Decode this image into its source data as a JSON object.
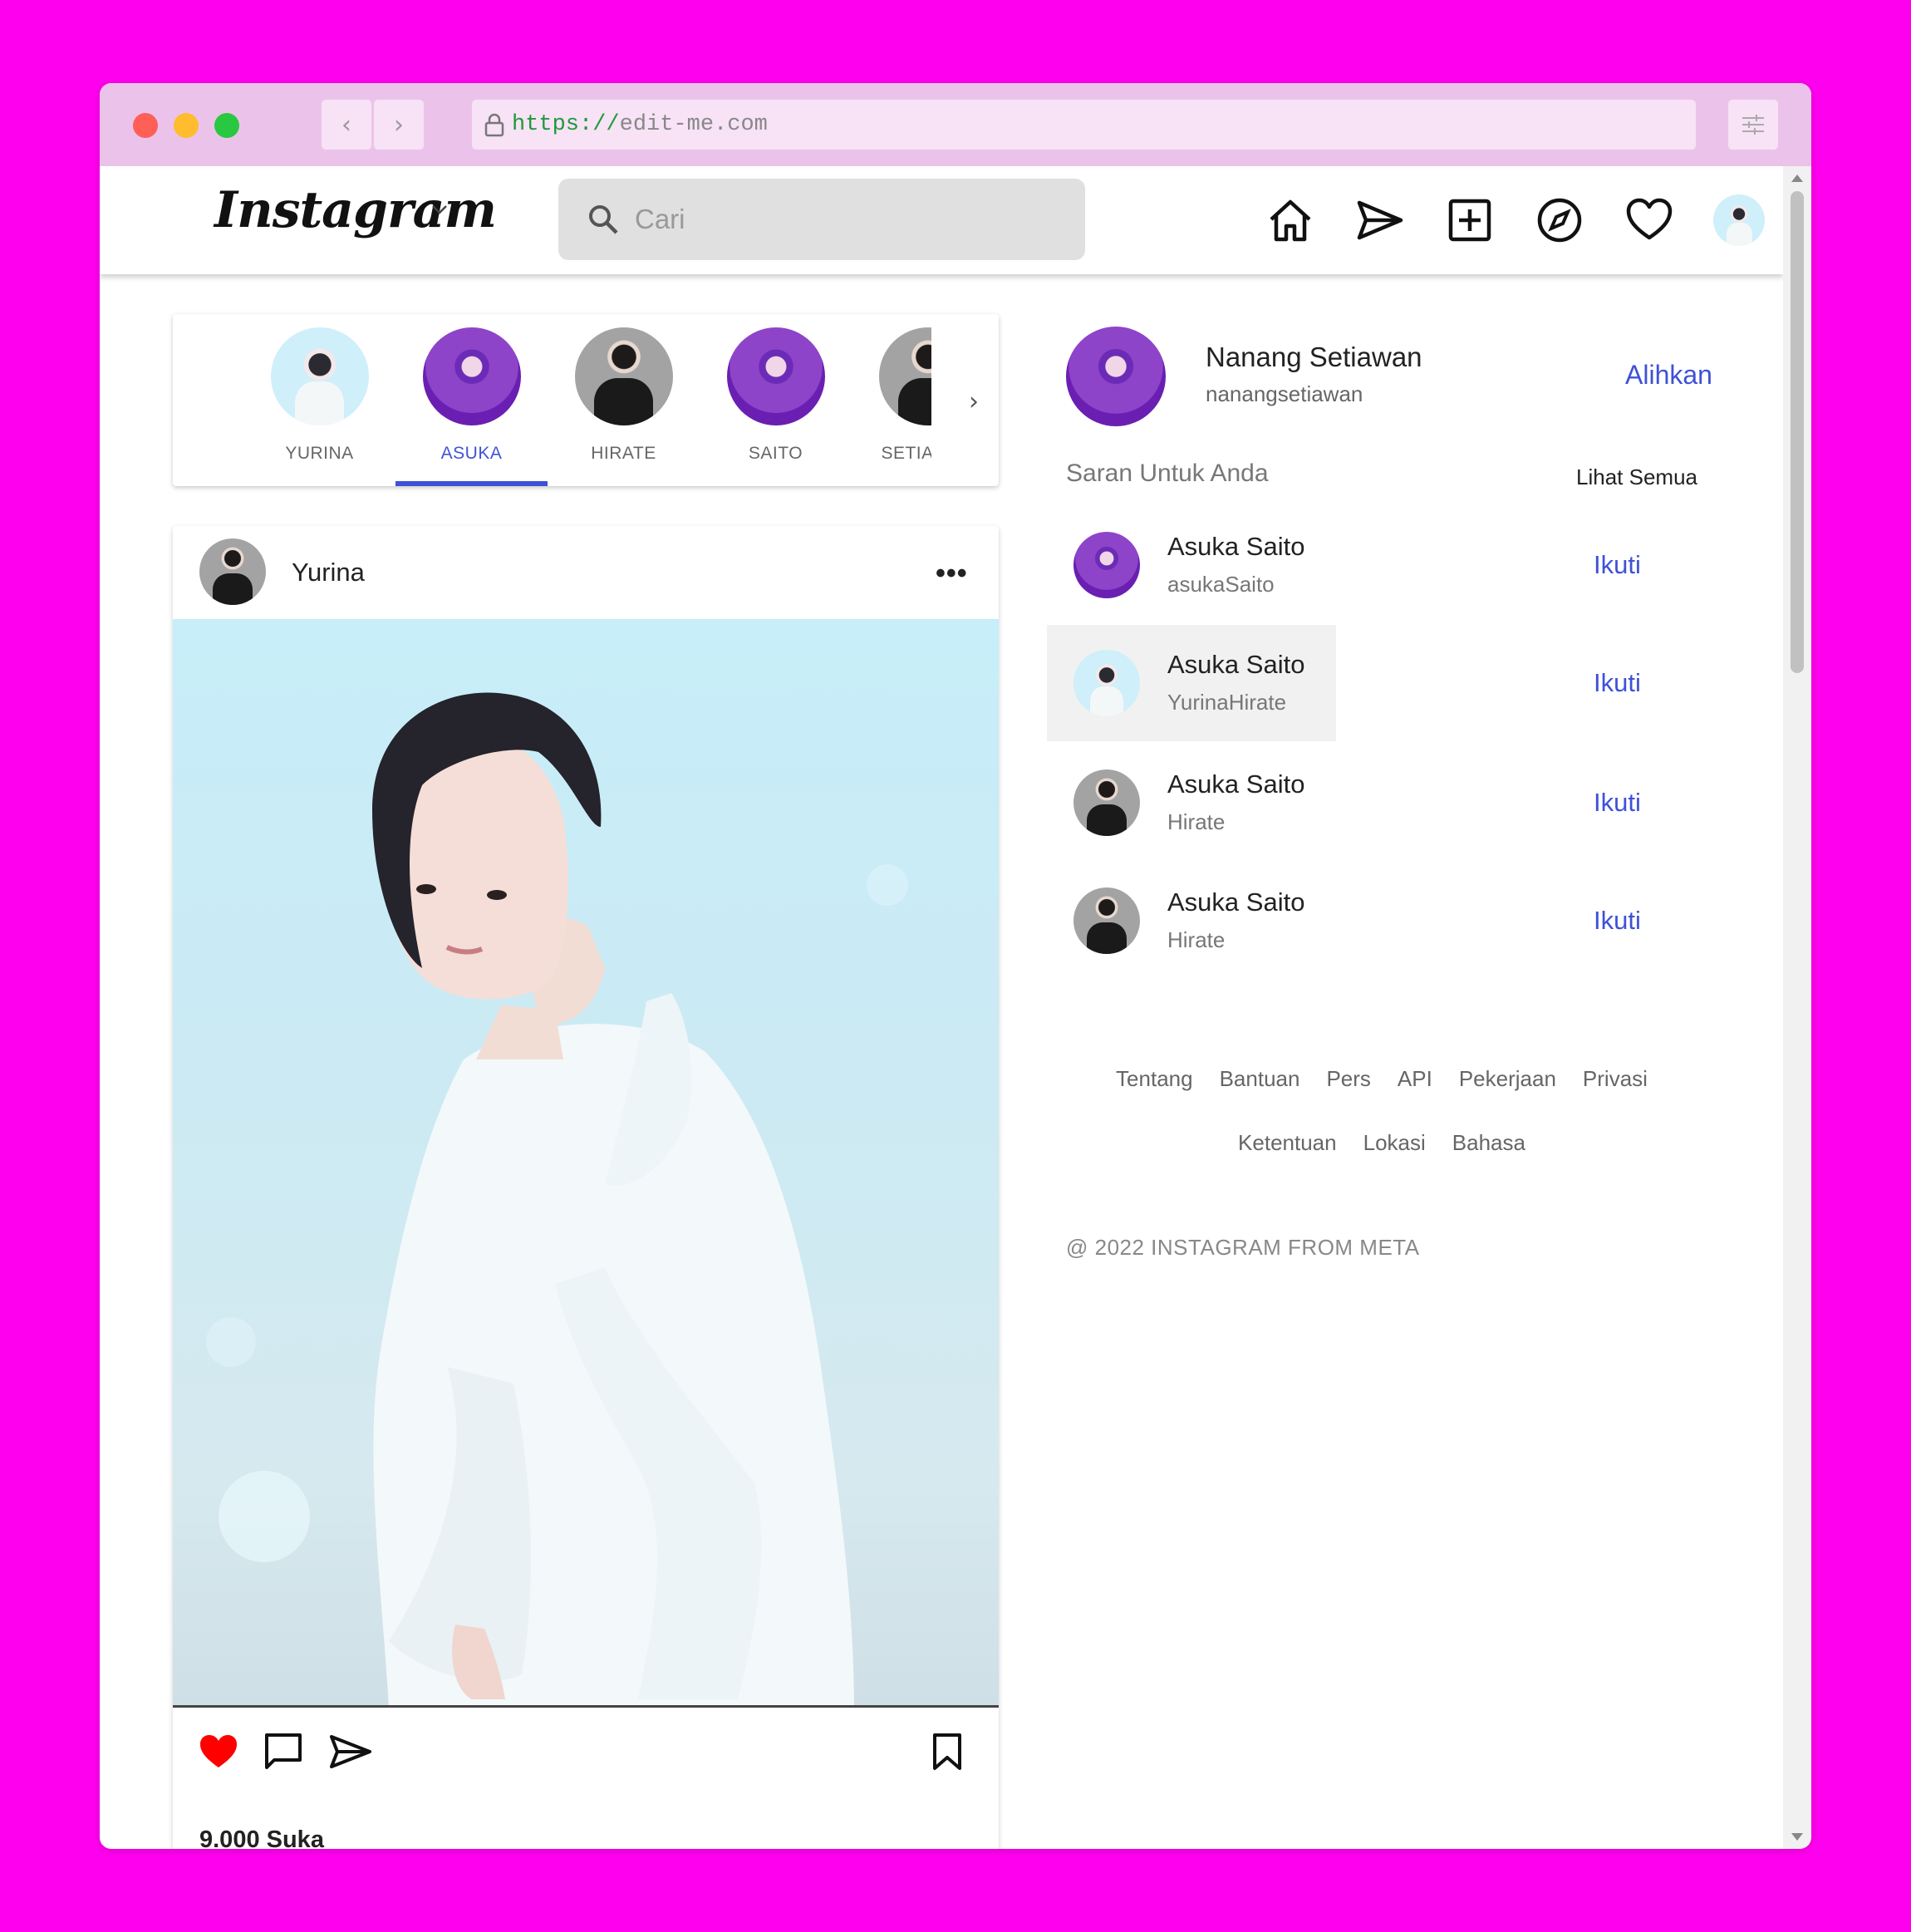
{
  "browser": {
    "url_protocol": "https://",
    "url_host": "edit-me.com"
  },
  "header": {
    "logo": "Instagram",
    "search_placeholder": "Cari"
  },
  "stories": [
    {
      "label": "YURINA",
      "style": "light",
      "active": false
    },
    {
      "label": "ASUKA",
      "style": "purple",
      "active": true
    },
    {
      "label": "HIRATE",
      "style": "dark",
      "active": false
    },
    {
      "label": "SAITO",
      "style": "purple",
      "active": false
    },
    {
      "label": "SETIAWAN",
      "style": "dark",
      "active": false
    }
  ],
  "post": {
    "author": "Yurina",
    "likes": "9.000 Suka"
  },
  "profile": {
    "name": "Nanang Setiawan",
    "username": "nanangsetiawan",
    "switch_label": "Alihkan"
  },
  "suggestions": {
    "title": "Saran Untuk Anda",
    "see_all": "Lihat Semua",
    "items": [
      {
        "name": "Asuka Saito",
        "username": "asukaSaito",
        "follow": "Ikuti",
        "style": "purple"
      },
      {
        "name": "Asuka Saito",
        "username": "YurinaHirate",
        "follow": "Ikuti",
        "style": "light"
      },
      {
        "name": "Asuka Saito",
        "username": "Hirate",
        "follow": "Ikuti",
        "style": "dark"
      },
      {
        "name": "Asuka Saito",
        "username": "Hirate",
        "follow": "Ikuti",
        "style": "dark"
      }
    ]
  },
  "footer": {
    "links_row1": [
      "Tentang",
      "Bantuan",
      "Pers",
      "API",
      "Pekerjaan",
      "Privasi"
    ],
    "links_row2": [
      "Ketentuan",
      "Lokasi",
      "Bahasa"
    ],
    "copyright": "@ 2022 INSTAGRAM FROM META"
  },
  "colors": {
    "background": "#ff00ee",
    "chrome": "#ebc3ea",
    "accent": "#3f51d6",
    "like": "#ff0000"
  }
}
